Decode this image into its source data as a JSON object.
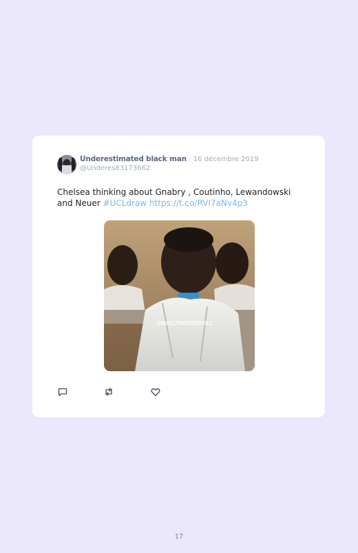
{
  "tweet": {
    "author_name": "Underestimated black man",
    "separator": "·",
    "date": "16 décembre 2019",
    "handle": "@Underes83173662",
    "text": "Chelsea thinking about Gnabry , Coutinho, Lewandowski and Neuer ",
    "hashtag": "#UCLdraw",
    "link": "https://t.co/RVI7aNv4p3",
    "media": {
      "watermark": "@NOLLYWOODROLL"
    },
    "actions": [
      {
        "name": "reply",
        "icon": "comment-icon"
      },
      {
        "name": "retweet",
        "icon": "retweet-icon"
      },
      {
        "name": "like",
        "icon": "heart-icon"
      }
    ]
  },
  "page": {
    "number": "17"
  },
  "colors": {
    "background": "#ebe7fd",
    "card": "#ffffff",
    "link": "#7ab7e8",
    "author": "#5b6a80",
    "muted": "#a2abb8"
  }
}
